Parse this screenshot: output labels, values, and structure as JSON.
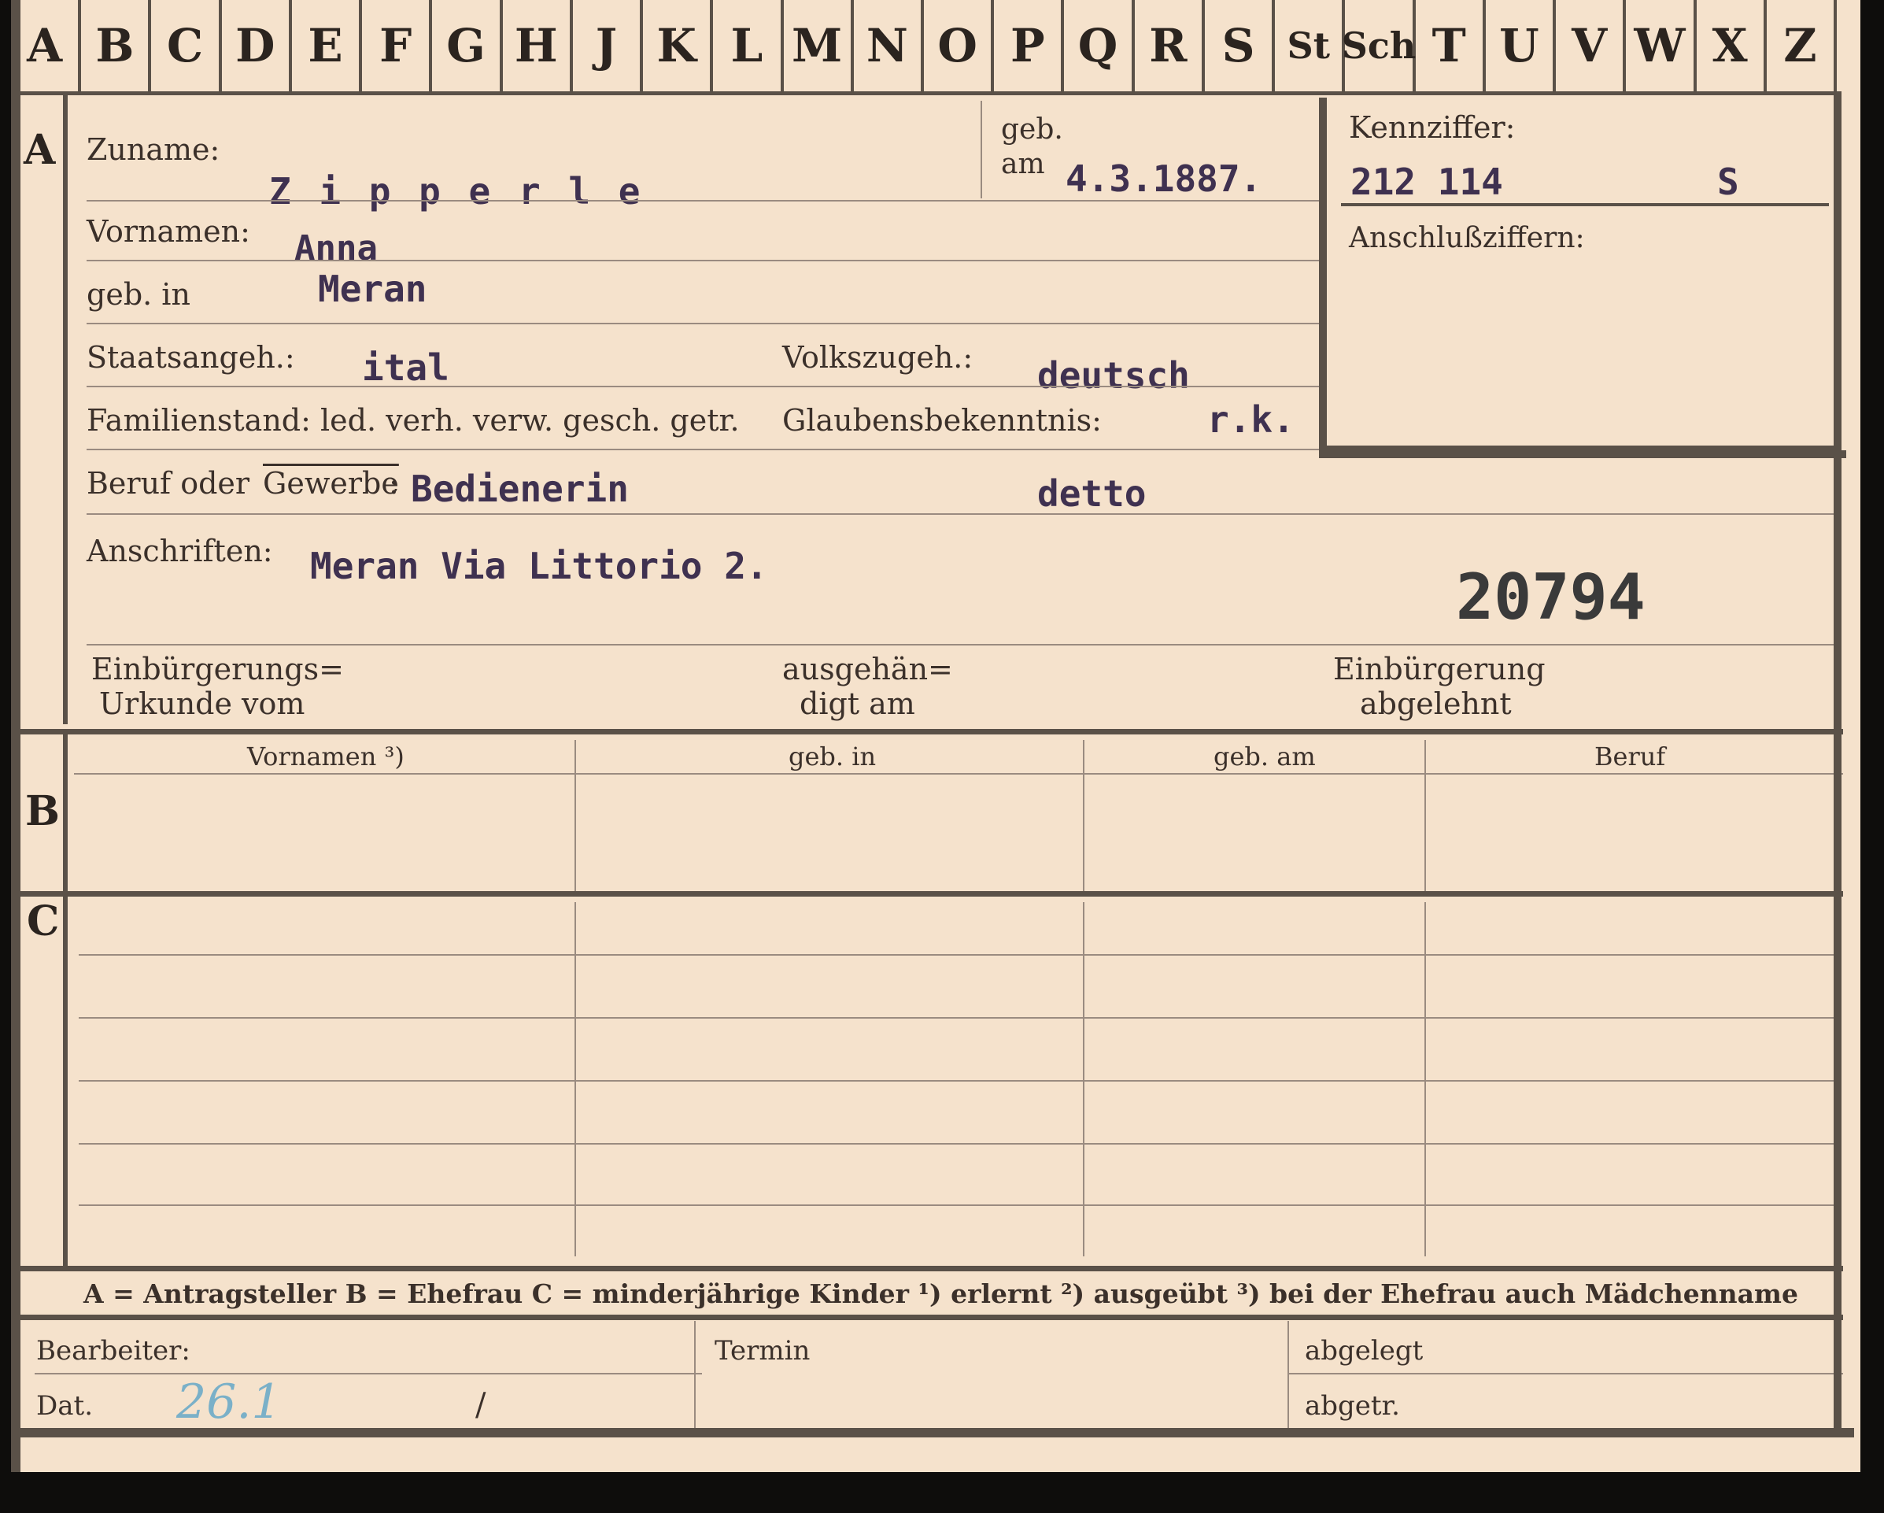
{
  "index_tabs": [
    "A",
    "B",
    "C",
    "D",
    "E",
    "F",
    "G",
    "H",
    "J",
    "K",
    "L",
    "M",
    "N",
    "O",
    "P",
    "Q",
    "R",
    "S",
    "St",
    "Sch",
    "T",
    "U",
    "V",
    "W",
    "X",
    "Z"
  ],
  "section_a": {
    "marker": "A",
    "surname_label": "Zuname:",
    "surname_value": "Z i p p e r l e",
    "born_label_1": "geb.",
    "born_label_2": "am",
    "born_value": "4.3.1887.",
    "id_label": "Kennziffer:",
    "id_value": "212 114",
    "id_suffix": "S",
    "link_label": "Anschlußziffern:",
    "given_label": "Vornamen:",
    "given_value": "Anna",
    "birthplace_label": "geb. in",
    "birthplace_value": "Meran",
    "citizenship_label": "Staatsangeh.:",
    "citizenship_value": "ital",
    "ethnicity_label": "Volkszugeh.:",
    "ethnicity_value": "deutsch",
    "family_label": "Familienstand: led. verh. verw. gesch. getr.",
    "religion_label": "Glaubensbekenntnis:",
    "religion_value": "r.k.",
    "occupation_label_1": "Beruf oder",
    "occupation_label_2": "Gewerbe",
    "occupation_label_3": ":",
    "occupation_value": "Bedienerin",
    "occupation_value_2": "detto",
    "address_label": "Anschriften:",
    "address_value": "Meran Via Littorio 2.",
    "stamp_number": "20794",
    "naturalization_doc_label_1": "Einbürgerungs=",
    "naturalization_doc_label_2": "Urkunde vom",
    "handed_label_1": "ausgehän=",
    "handed_label_2": "digt am",
    "refused_label_1": "Einbürgerung",
    "refused_label_2": "abgelehnt"
  },
  "section_b": {
    "marker": "B",
    "headers": [
      "Vornamen ³)",
      "geb. in",
      "geb. am",
      "Beruf"
    ]
  },
  "section_c": {
    "marker": "C"
  },
  "legend": "A = Antragsteller   B = Ehefrau   C = minderjährige Kinder   ¹) erlernt   ²) ausgeübt   ³) bei der Ehefrau auch Mädchenname",
  "footer": {
    "clerk_label": "Bearbeiter:",
    "date_label": "Dat.",
    "date_value": "26.1",
    "date_slash": "/",
    "term_label": "Termin",
    "filed_label": "abgelegt",
    "removed_label": "abgetr."
  },
  "colors": {
    "card": "#f5e2cc",
    "ink_typed": "#3f3150",
    "rule": "#5a5148",
    "handwriting": "#7ab0c8"
  }
}
